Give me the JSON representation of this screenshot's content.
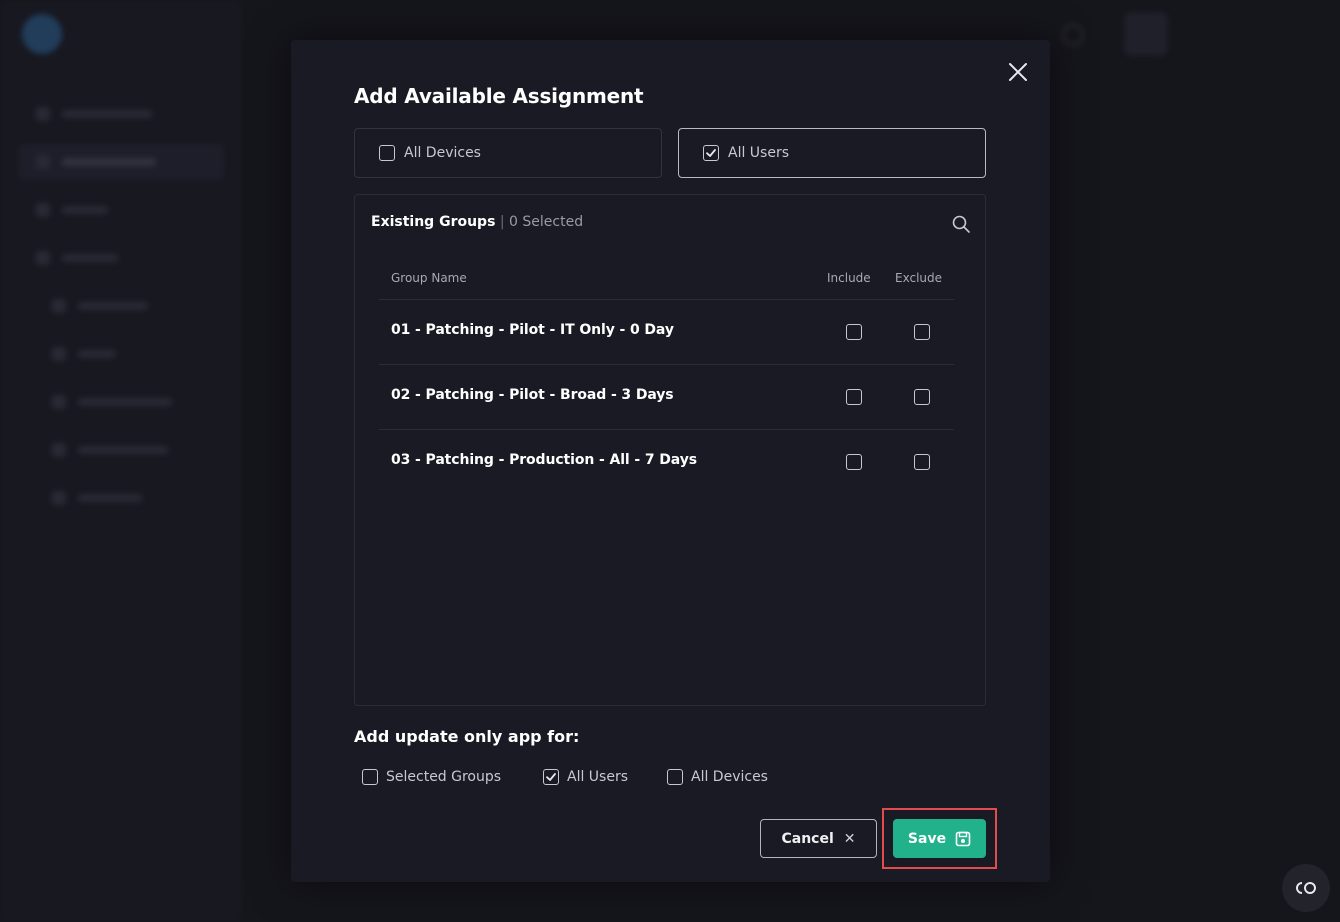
{
  "modal": {
    "title": "Add Available Assignment",
    "targets": [
      {
        "label": "All Devices",
        "checked": false
      },
      {
        "label": "All Users",
        "checked": true
      }
    ],
    "groups": {
      "title": "Existing Groups",
      "separator": "|",
      "selected_count": "0 Selected",
      "columns": {
        "name": "Group Name",
        "include": "Include",
        "exclude": "Exclude"
      },
      "rows": [
        {
          "name": "01 - Patching - Pilot - IT Only - 0 Day",
          "include": false,
          "exclude": false
        },
        {
          "name": "02 - Patching - Pilot - Broad - 3 Days",
          "include": false,
          "exclude": false
        },
        {
          "name": "03 - Patching - Production - All - 7 Days",
          "include": false,
          "exclude": false
        }
      ]
    },
    "update_only": {
      "title": "Add update only app for:",
      "options": [
        {
          "label": "Selected Groups",
          "checked": false
        },
        {
          "label": "All Users",
          "checked": true
        },
        {
          "label": "All Devices",
          "checked": false
        }
      ]
    },
    "buttons": {
      "cancel": "Cancel",
      "save": "Save"
    }
  },
  "colors": {
    "accent": "#21b28c",
    "highlight": "#e34c4c",
    "modal_bg": "#1a1a24"
  }
}
